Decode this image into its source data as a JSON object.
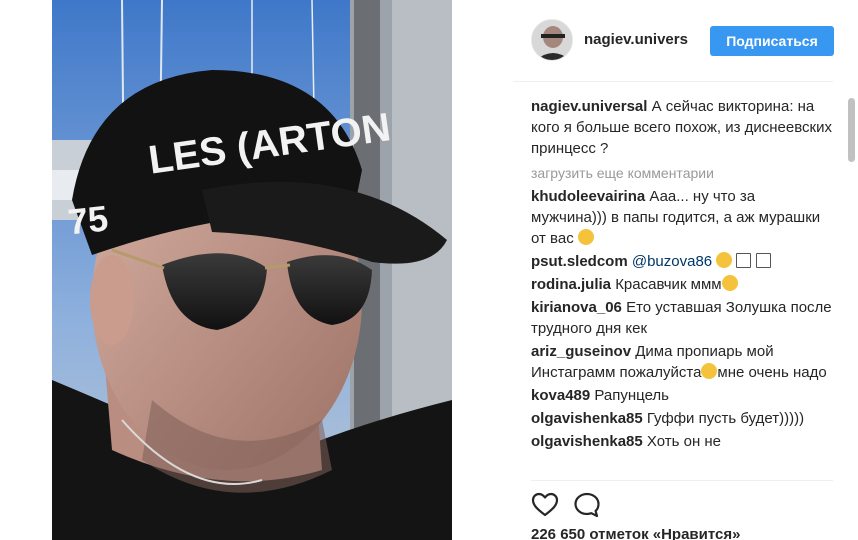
{
  "post": {
    "author": "nagiev.universal",
    "header_username": "nagiev.univers",
    "follow_label": "Подписаться",
    "caption": {
      "user": "nagiev.universal",
      "text": "А сейчас викторина: на кого я больше всего похож, из диснеевских принцесс ?"
    },
    "load_more_label": "загрузить еще комментарии",
    "likes_text": "226 650 отметок «Нравится»",
    "photo_cap_text": "LES (ARTON",
    "photo_cap_number": "75"
  },
  "comments": [
    {
      "user": "khudoleevairina",
      "text": "Ааа... ну что за мужчина))) в папы годится, а аж мурашки от вас",
      "emoji": "wink-face-emoji"
    },
    {
      "user": "psut.sledcom",
      "mention": "@buzova86",
      "emoji": "laughing-crying-emoji"
    },
    {
      "user": "rodina.julia",
      "text": "Красавчик ммм",
      "emoji": "heart-eyes-emoji"
    },
    {
      "user": "kirianova_06",
      "text": "Ето уставшая Золушка после трудного дня кек"
    },
    {
      "user": "ariz_guseinov",
      "text_before": "Дима пропиарь мой Инстаграмм пожалуйста",
      "text_after": "мне очень надо",
      "emoji": "crying-face-emoji"
    },
    {
      "user": "kova489",
      "text": "Рапунцель"
    },
    {
      "user": "olgavishenka85",
      "text": "Гуффи пусть будет)))))"
    },
    {
      "user": "olgavishenka85",
      "text": "Хоть он не"
    }
  ],
  "icons": {
    "like": "heart-outline-icon",
    "comment": "speech-bubble-icon"
  },
  "colors": {
    "follow_button": "#3897f0",
    "mention": "#003569",
    "muted": "#999999",
    "text": "#262626"
  }
}
